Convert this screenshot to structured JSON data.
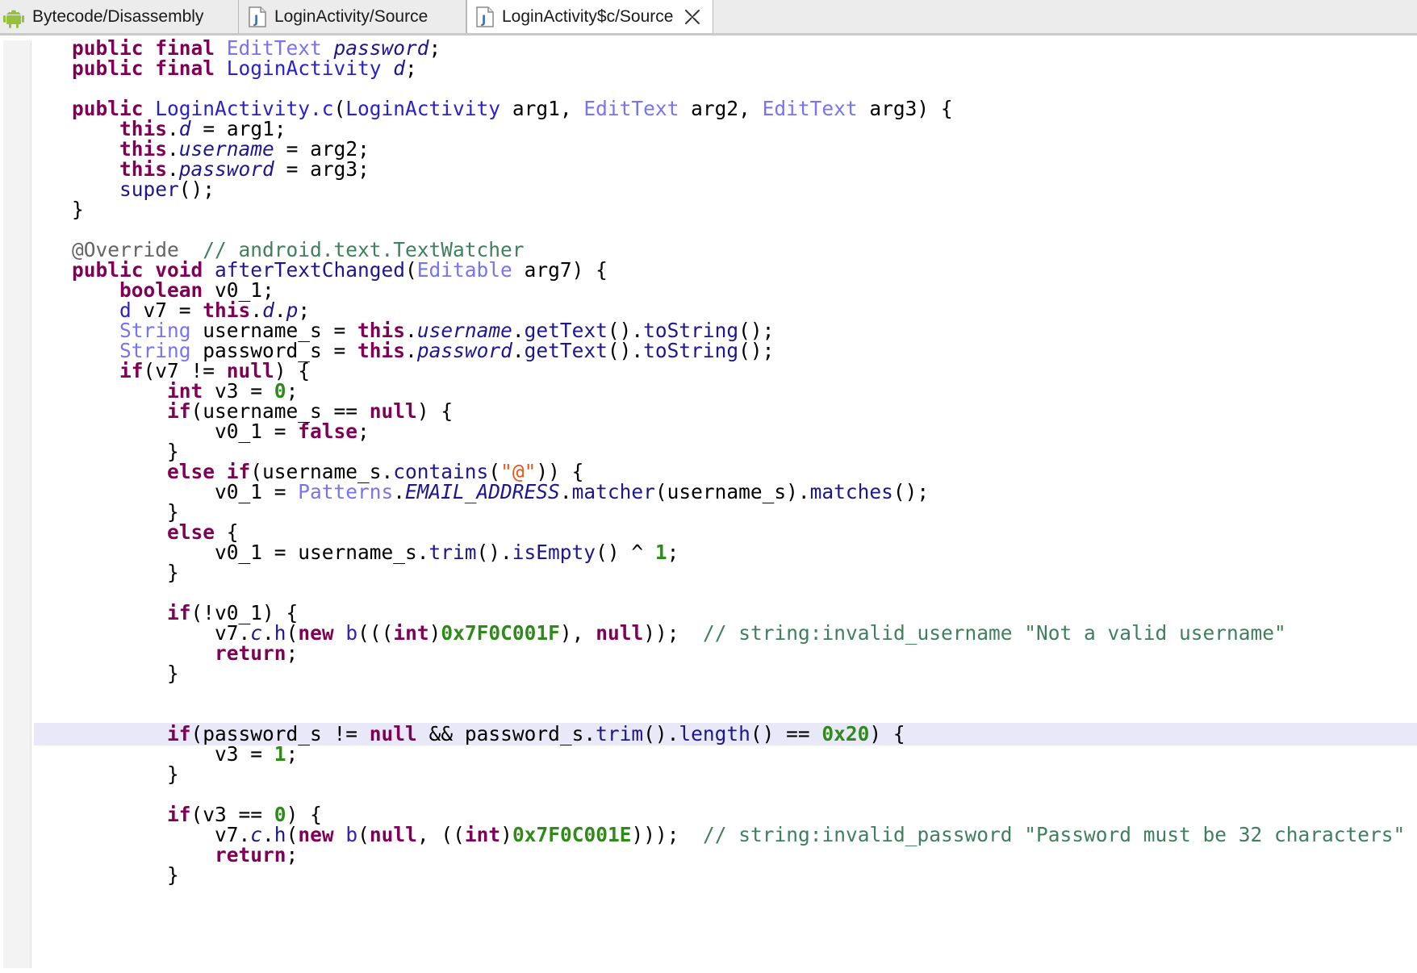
{
  "tabs": [
    {
      "label": "Bytecode/Disassembly",
      "icon": "android-icon",
      "active": false
    },
    {
      "label": "LoginActivity/Source",
      "icon": "java-file-icon",
      "active": false
    },
    {
      "label": "LoginActivity$c/Source",
      "icon": "java-file-icon",
      "active": true,
      "closable": true
    }
  ],
  "colors": {
    "keyword": "#7f0055",
    "type": "#7873f0",
    "field": "#1d168f",
    "comment": "#3f7f5f",
    "number": "#2f8a1a",
    "string": "#e8571d",
    "current_line": "#e8e8f9"
  },
  "code": {
    "current_line": 34,
    "lines": [
      [
        [
          "kw",
          "public final "
        ],
        [
          "ty",
          "EditText "
        ],
        [
          "fld",
          "password"
        ],
        [
          "pl",
          ";"
        ]
      ],
      [
        [
          "kw",
          "public final "
        ],
        [
          "cls",
          "LoginActivity "
        ],
        [
          "fld",
          "d"
        ],
        [
          "pl",
          ";"
        ]
      ],
      [],
      [
        [
          "kw",
          "public "
        ],
        [
          "cls",
          "LoginActivity.c"
        ],
        [
          "pl",
          "("
        ],
        [
          "cls",
          "LoginActivity"
        ],
        [
          "pl",
          " arg1, "
        ],
        [
          "ty",
          "EditText"
        ],
        [
          "pl",
          " arg2, "
        ],
        [
          "ty",
          "EditText"
        ],
        [
          "pl",
          " arg3) {"
        ]
      ],
      [
        [
          "pl",
          "    "
        ],
        [
          "kw",
          "this"
        ],
        [
          "pl",
          "."
        ],
        [
          "fld",
          "d"
        ],
        [
          "pl",
          " = arg1;"
        ]
      ],
      [
        [
          "pl",
          "    "
        ],
        [
          "kw",
          "this"
        ],
        [
          "pl",
          "."
        ],
        [
          "fld",
          "username"
        ],
        [
          "pl",
          " = arg2;"
        ]
      ],
      [
        [
          "pl",
          "    "
        ],
        [
          "kw",
          "this"
        ],
        [
          "pl",
          "."
        ],
        [
          "fld",
          "password"
        ],
        [
          "pl",
          " = arg3;"
        ]
      ],
      [
        [
          "pl",
          "    "
        ],
        [
          "mth",
          "super"
        ],
        [
          "pl",
          "();"
        ]
      ],
      [
        [
          "pl",
          "}"
        ]
      ],
      [],
      [
        [
          "ann",
          "@Override  "
        ],
        [
          "cm",
          "// android.text.TextWatcher"
        ]
      ],
      [
        [
          "kw",
          "public void "
        ],
        [
          "mth",
          "afterTextChanged"
        ],
        [
          "pl",
          "("
        ],
        [
          "ty",
          "Editable"
        ],
        [
          "pl",
          " arg7) {"
        ]
      ],
      [
        [
          "pl",
          "    "
        ],
        [
          "kw",
          "boolean"
        ],
        [
          "pl",
          " v0_1;"
        ]
      ],
      [
        [
          "pl",
          "    "
        ],
        [
          "cls",
          "d"
        ],
        [
          "pl",
          " v7 = "
        ],
        [
          "kw",
          "this"
        ],
        [
          "pl",
          "."
        ],
        [
          "fld",
          "d"
        ],
        [
          "pl",
          "."
        ],
        [
          "fld",
          "p"
        ],
        [
          "pl",
          ";"
        ]
      ],
      [
        [
          "pl",
          "    "
        ],
        [
          "ty",
          "String"
        ],
        [
          "pl",
          " username_s = "
        ],
        [
          "kw",
          "this"
        ],
        [
          "pl",
          "."
        ],
        [
          "fld",
          "username"
        ],
        [
          "pl",
          "."
        ],
        [
          "mth",
          "getText"
        ],
        [
          "pl",
          "()."
        ],
        [
          "mth",
          "toString"
        ],
        [
          "pl",
          "();"
        ]
      ],
      [
        [
          "pl",
          "    "
        ],
        [
          "ty",
          "String"
        ],
        [
          "pl",
          " password_s = "
        ],
        [
          "kw",
          "this"
        ],
        [
          "pl",
          "."
        ],
        [
          "fld",
          "password"
        ],
        [
          "pl",
          "."
        ],
        [
          "mth",
          "getText"
        ],
        [
          "pl",
          "()."
        ],
        [
          "mth",
          "toString"
        ],
        [
          "pl",
          "();"
        ]
      ],
      [
        [
          "pl",
          "    "
        ],
        [
          "kw",
          "if"
        ],
        [
          "pl",
          "(v7 != "
        ],
        [
          "kw",
          "null"
        ],
        [
          "pl",
          ") {"
        ]
      ],
      [
        [
          "pl",
          "        "
        ],
        [
          "kw",
          "int"
        ],
        [
          "pl",
          " v3 = "
        ],
        [
          "num",
          "0"
        ],
        [
          "pl",
          ";"
        ]
      ],
      [
        [
          "pl",
          "        "
        ],
        [
          "kw",
          "if"
        ],
        [
          "pl",
          "(username_s == "
        ],
        [
          "kw",
          "null"
        ],
        [
          "pl",
          ") {"
        ]
      ],
      [
        [
          "pl",
          "            v0_1 = "
        ],
        [
          "kw",
          "false"
        ],
        [
          "pl",
          ";"
        ]
      ],
      [
        [
          "pl",
          "        }"
        ]
      ],
      [
        [
          "pl",
          "        "
        ],
        [
          "kw",
          "else if"
        ],
        [
          "pl",
          "(username_s."
        ],
        [
          "mth",
          "contains"
        ],
        [
          "pl",
          "("
        ],
        [
          "str",
          "\"@\""
        ],
        [
          "pl",
          ")) {"
        ]
      ],
      [
        [
          "pl",
          "            v0_1 = "
        ],
        [
          "ty",
          "Patterns"
        ],
        [
          "pl",
          "."
        ],
        [
          "fld",
          "EMAIL_ADDRESS"
        ],
        [
          "pl",
          "."
        ],
        [
          "mth",
          "matcher"
        ],
        [
          "pl",
          "(username_s)."
        ],
        [
          "mth",
          "matches"
        ],
        [
          "pl",
          "();"
        ]
      ],
      [
        [
          "pl",
          "        }"
        ]
      ],
      [
        [
          "pl",
          "        "
        ],
        [
          "kw",
          "else"
        ],
        [
          "pl",
          " {"
        ]
      ],
      [
        [
          "pl",
          "            v0_1 = username_s."
        ],
        [
          "mth",
          "trim"
        ],
        [
          "pl",
          "()."
        ],
        [
          "mth",
          "isEmpty"
        ],
        [
          "pl",
          "() ^ "
        ],
        [
          "num",
          "1"
        ],
        [
          "pl",
          ";"
        ]
      ],
      [
        [
          "pl",
          "        }"
        ]
      ],
      [],
      [
        [
          "pl",
          "        "
        ],
        [
          "kw",
          "if"
        ],
        [
          "pl",
          "(!v0_1) {"
        ]
      ],
      [
        [
          "pl",
          "            v7."
        ],
        [
          "fld",
          "c"
        ],
        [
          "pl",
          "."
        ],
        [
          "mth",
          "h"
        ],
        [
          "pl",
          "("
        ],
        [
          "kw",
          "new "
        ],
        [
          "cls",
          "b"
        ],
        [
          "pl",
          "((("
        ],
        [
          "kw",
          "int"
        ],
        [
          "pl",
          ")"
        ],
        [
          "num",
          "0x7F0C001F"
        ],
        [
          "pl",
          "), "
        ],
        [
          "kw",
          "null"
        ],
        [
          "pl",
          "));  "
        ],
        [
          "cm",
          "// string:invalid_username \"Not a valid username\""
        ]
      ],
      [
        [
          "pl",
          "            "
        ],
        [
          "kw",
          "return"
        ],
        [
          "pl",
          ";"
        ]
      ],
      [
        [
          "pl",
          "        }"
        ]
      ],
      [],
      [],
      [
        [
          "pl",
          "        "
        ],
        [
          "kw",
          "if"
        ],
        [
          "pl",
          "(password_s != "
        ],
        [
          "kw",
          "null"
        ],
        [
          "pl",
          " && password_s."
        ],
        [
          "mth",
          "trim"
        ],
        [
          "pl",
          "()."
        ],
        [
          "mth",
          "length"
        ],
        [
          "pl",
          "() == "
        ],
        [
          "num",
          "0x20"
        ],
        [
          "pl",
          ") {"
        ]
      ],
      [
        [
          "pl",
          "            v3 = "
        ],
        [
          "num",
          "1"
        ],
        [
          "pl",
          ";"
        ]
      ],
      [
        [
          "pl",
          "        }"
        ]
      ],
      [],
      [
        [
          "pl",
          "        "
        ],
        [
          "kw",
          "if"
        ],
        [
          "pl",
          "(v3 == "
        ],
        [
          "num",
          "0"
        ],
        [
          "pl",
          ") {"
        ]
      ],
      [
        [
          "pl",
          "            v7."
        ],
        [
          "fld",
          "c"
        ],
        [
          "pl",
          "."
        ],
        [
          "mth",
          "h"
        ],
        [
          "pl",
          "("
        ],
        [
          "kw",
          "new "
        ],
        [
          "cls",
          "b"
        ],
        [
          "pl",
          "("
        ],
        [
          "kw",
          "null"
        ],
        [
          "pl",
          ", (("
        ],
        [
          "kw",
          "int"
        ],
        [
          "pl",
          ")"
        ],
        [
          "num",
          "0x7F0C001E"
        ],
        [
          "pl",
          ")));  "
        ],
        [
          "cm",
          "// string:invalid_password \"Password must be 32 characters\""
        ]
      ],
      [
        [
          "pl",
          "            "
        ],
        [
          "kw",
          "return"
        ],
        [
          "pl",
          ";"
        ]
      ],
      [
        [
          "pl",
          "        }"
        ]
      ]
    ]
  }
}
